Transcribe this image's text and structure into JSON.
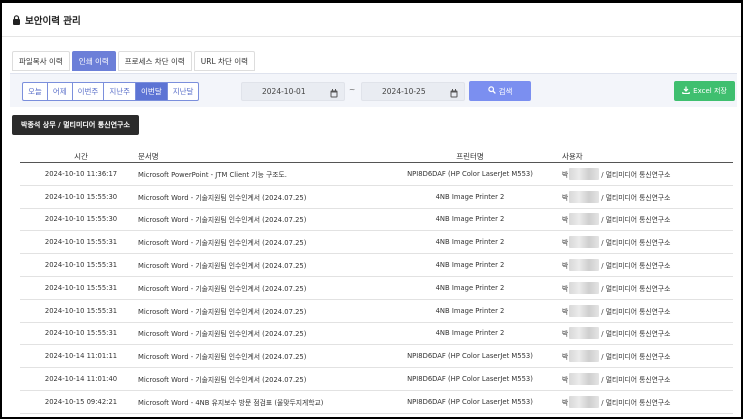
{
  "header": {
    "title": "보안이력 관리",
    "icon": "lock-icon"
  },
  "tabs": [
    {
      "label": "파일복사 이력",
      "active": false
    },
    {
      "label": "인쇄 이력",
      "active": true
    },
    {
      "label": "프로세스 차단 이력",
      "active": false
    },
    {
      "label": "URL 차단 이력",
      "active": false
    }
  ],
  "filter": {
    "periods": [
      {
        "label": "오늘",
        "active": false
      },
      {
        "label": "어제",
        "active": false
      },
      {
        "label": "이번주",
        "active": false
      },
      {
        "label": "지난주",
        "active": false
      },
      {
        "label": "이번달",
        "active": true
      },
      {
        "label": "지난달",
        "active": false
      }
    ],
    "start_date": "2024-10-01",
    "end_date": "2024-10-25",
    "separator": "~",
    "search_label": "검색",
    "excel_label": "Excel 저장"
  },
  "user_badge": "박종석 상무 / 멀티미디어 통신연구소",
  "table": {
    "columns": {
      "time": "시간",
      "document": "문서명",
      "printer": "프린터명",
      "user": "사용자"
    },
    "rows": [
      {
        "time": "2024-10-10 11:36:17",
        "document": "Microsoft PowerPoint - JTM Client 기능 구조도.",
        "printer": "NPI8D6DAF (HP Color LaserJet M553)",
        "user_prefix": "박",
        "user_suffix": "/ 멀티미디어 통신연구소"
      },
      {
        "time": "2024-10-10 15:55:30",
        "document": "Microsoft Word - 기술지원팀 인수인계서 (2024.07.25)",
        "printer": "4NB Image Printer 2",
        "user_prefix": "박",
        "user_suffix": "/ 멀티미디어 통신연구소"
      },
      {
        "time": "2024-10-10 15:55:30",
        "document": "Microsoft Word - 기술지원팀 인수인계서 (2024.07.25)",
        "printer": "4NB Image Printer 2",
        "user_prefix": "박",
        "user_suffix": "/ 멀티미디어 통신연구소"
      },
      {
        "time": "2024-10-10 15:55:31",
        "document": "Microsoft Word - 기술지원팀 인수인계서 (2024.07.25)",
        "printer": "4NB Image Printer 2",
        "user_prefix": "박",
        "user_suffix": "/ 멀티미디어 통신연구소"
      },
      {
        "time": "2024-10-10 15:55:31",
        "document": "Microsoft Word - 기술지원팀 인수인계서 (2024.07.25)",
        "printer": "4NB Image Printer 2",
        "user_prefix": "박",
        "user_suffix": "/ 멀티미디어 통신연구소"
      },
      {
        "time": "2024-10-10 15:55:31",
        "document": "Microsoft Word - 기술지원팀 인수인계서 (2024.07.25)",
        "printer": "4NB Image Printer 2",
        "user_prefix": "박",
        "user_suffix": "/ 멀티미디어 통신연구소"
      },
      {
        "time": "2024-10-10 15:55:31",
        "document": "Microsoft Word - 기술지원팀 인수인계서 (2024.07.25)",
        "printer": "4NB Image Printer 2",
        "user_prefix": "박",
        "user_suffix": "/ 멀티미디어 통신연구소"
      },
      {
        "time": "2024-10-10 15:55:31",
        "document": "Microsoft Word - 기술지원팀 인수인계서 (2024.07.25)",
        "printer": "4NB Image Printer 2",
        "user_prefix": "박",
        "user_suffix": "/ 멀티미디어 통신연구소"
      },
      {
        "time": "2024-10-14 11:01:11",
        "document": "Microsoft Word - 기술지원팀 인수인계서 (2024.07.25)",
        "printer": "NPI8D6DAF (HP Color LaserJet M553)",
        "user_prefix": "박",
        "user_suffix": "/ 멀티미디어 통신연구소"
      },
      {
        "time": "2024-10-14 11:01:40",
        "document": "Microsoft Word - 기술지원팀 인수인계서 (2024.07.25)",
        "printer": "NPI8D6DAF (HP Color LaserJet M553)",
        "user_prefix": "박",
        "user_suffix": "/ 멀티미디어 통신연구소"
      },
      {
        "time": "2024-10-15 09:42:21",
        "document": "Microsoft Word - 4NB 유지보수 방문 점검표 (울맞두지게학교)",
        "printer": "NPI8D6DAF (HP Color LaserJet M553)",
        "user_prefix": "박",
        "user_suffix": "/ 멀티미디어 통신연구소"
      }
    ]
  },
  "colors": {
    "accent": "#6c7fd8",
    "search": "#7b8ff0",
    "excel": "#3fbf6f",
    "badge": "#2b2b2b"
  }
}
